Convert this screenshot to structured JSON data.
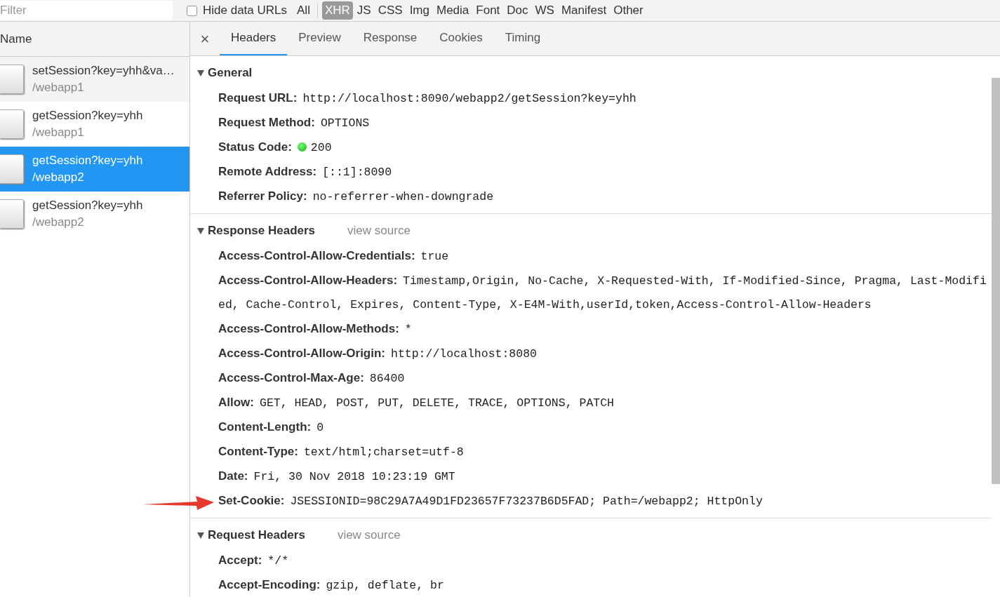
{
  "filter_bar": {
    "placeholder": "Filter",
    "hide_data_urls": {
      "label": "Hide data URLs",
      "checked": false
    },
    "types": [
      {
        "label": "All",
        "selected": false
      },
      {
        "label": "XHR",
        "selected": true
      },
      {
        "label": "JS",
        "selected": false
      },
      {
        "label": "CSS",
        "selected": false
      },
      {
        "label": "Img",
        "selected": false
      },
      {
        "label": "Media",
        "selected": false
      },
      {
        "label": "Font",
        "selected": false
      },
      {
        "label": "Doc",
        "selected": false
      },
      {
        "label": "WS",
        "selected": false
      },
      {
        "label": "Manifest",
        "selected": false
      },
      {
        "label": "Other",
        "selected": false
      }
    ]
  },
  "requests": {
    "column": "Name",
    "rows": [
      {
        "name": "setSession?key=yhh&va…",
        "path": "/webapp1",
        "selected": false,
        "hovered": true
      },
      {
        "name": "getSession?key=yhh",
        "path": "/webapp1",
        "selected": false,
        "hovered": false
      },
      {
        "name": "getSession?key=yhh",
        "path": "/webapp2",
        "selected": true,
        "hovered": false
      },
      {
        "name": "getSession?key=yhh",
        "path": "/webapp2",
        "selected": false,
        "hovered": false
      }
    ]
  },
  "detail": {
    "close": "×",
    "tabs": [
      {
        "label": "Headers",
        "selected": true
      },
      {
        "label": "Preview",
        "selected": false
      },
      {
        "label": "Response",
        "selected": false
      },
      {
        "label": "Cookies",
        "selected": false
      },
      {
        "label": "Timing",
        "selected": false
      }
    ],
    "sections": [
      {
        "title": "General",
        "expanded": true,
        "items": [
          {
            "key": "Request URL:",
            "value": "http://localhost:8090/webapp2/getSession?key=yhh",
            "kind": "plain"
          },
          {
            "key": "Request Method:",
            "value": "OPTIONS",
            "kind": "plain"
          },
          {
            "key": "Status Code:",
            "value": "200",
            "kind": "status"
          },
          {
            "key": "Remote Address:",
            "value": "[::1]:8090",
            "kind": "plain"
          },
          {
            "key": "Referrer Policy:",
            "value": "no-referrer-when-downgrade",
            "kind": "plain"
          }
        ]
      },
      {
        "title": "Response Headers",
        "link": "view source",
        "expanded": true,
        "items": [
          {
            "key": "Access-Control-Allow-Credentials:",
            "value": "true",
            "kind": "plain"
          },
          {
            "key": "Access-Control-Allow-Headers:",
            "value": "Timestamp,Origin, No-Cache, X-Requested-With, If-Modified-Since, Pragma, Last-Modified, Cache-Control, Expires, Content-Type, X-E4M-With,userId,token,Access-Control-Allow-Headers",
            "kind": "plain"
          },
          {
            "key": "Access-Control-Allow-Methods:",
            "value": "*",
            "kind": "plain"
          },
          {
            "key": "Access-Control-Allow-Origin:",
            "value": "http://localhost:8080",
            "kind": "plain"
          },
          {
            "key": "Access-Control-Max-Age:",
            "value": "86400",
            "kind": "plain"
          },
          {
            "key": "Allow:",
            "value": "GET, HEAD, POST, PUT, DELETE, TRACE, OPTIONS, PATCH",
            "kind": "plain"
          },
          {
            "key": "Content-Length:",
            "value": "0",
            "kind": "plain"
          },
          {
            "key": "Content-Type:",
            "value": "text/html;charset=utf-8",
            "kind": "plain"
          },
          {
            "key": "Date:",
            "value": "Fri, 30 Nov 2018 10:23:19 GMT",
            "kind": "plain"
          },
          {
            "key": "Set-Cookie:",
            "value": "JSESSIONID=98C29A7A49D1FD23657F73237B6D5FAD; Path=/webapp2; HttpOnly",
            "kind": "marked"
          }
        ]
      },
      {
        "title": "Request Headers",
        "link": "view source",
        "expanded": true,
        "items": [
          {
            "key": "Accept:",
            "value": "*/*",
            "kind": "plain"
          },
          {
            "key": "Accept-Encoding:",
            "value": "gzip, deflate, br",
            "kind": "plain"
          }
        ]
      }
    ]
  }
}
